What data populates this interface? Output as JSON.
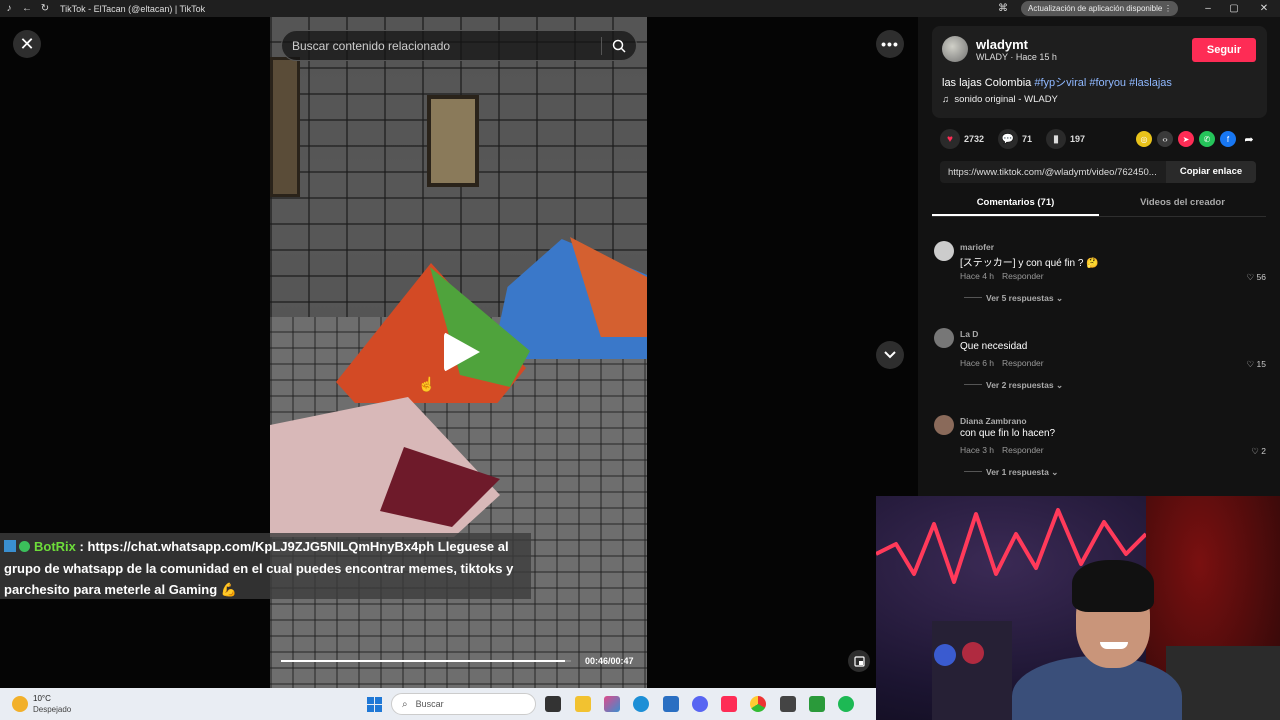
{
  "browser": {
    "tab_title": "TikTok - ElTacan (@eltacan) | TikTok",
    "update_notice": "Actualización de aplicación disponible"
  },
  "search": {
    "placeholder": "Buscar contenido relacionado"
  },
  "player": {
    "time": "00:46/00:47",
    "progress": 0.979
  },
  "chat_overlay": {
    "username": "BotRix",
    "message": ": https://chat.whatsapp.com/KpLJ9ZJG5NILQmHnyBx4ph Lleguese al grupo de whatsapp de la comunidad en el cual puedes encontrar memes, tiktoks y parchesito para meterle al Gaming 💪"
  },
  "creator": {
    "name": "wladymt",
    "sub": "WLADY · Hace 15 h",
    "follow_label": "Seguir",
    "caption_text": "las lajas Colombia",
    "hashtags": [
      "#fypシviral",
      "#foryou",
      "#laslajas"
    ],
    "sound": "sonido original - WLADY"
  },
  "stats": {
    "likes": "2732",
    "comments": "71",
    "saves": "197"
  },
  "share_icons": [
    "coin-icon",
    "embed-icon",
    "send-icon",
    "whatsapp-icon",
    "facebook-icon",
    "share-arrow-icon"
  ],
  "link": {
    "url": "https://www.tiktok.com/@wladymt/video/762450...",
    "copy_label": "Copiar enlace"
  },
  "tabs": [
    "Comentarios (71)",
    "Videos del creador"
  ],
  "comments": [
    {
      "user": "mariofer",
      "text": "[ステッカー] y con qué fin ? 🤔",
      "time": "Hace 4 h",
      "reply": "Responder",
      "likes": "56",
      "replies": "Ver 5 respuestas"
    },
    {
      "user": "La D",
      "text": "Que necesidad",
      "time": "Hace 6 h",
      "reply": "Responder",
      "likes": "15",
      "replies": "Ver 2 respuestas"
    },
    {
      "user": "Diana Zambrano",
      "text": "con que fin lo hacen?",
      "time": "Hace 3 h",
      "reply": "Responder",
      "likes": "2",
      "replies": "Ver 1 respuesta"
    }
  ],
  "taskbar": {
    "temp": "10°C",
    "weather": "Despejado",
    "search_label": "Buscar"
  },
  "colors": {
    "accent": "#fe2c55",
    "hashtag": "#8fb8ff",
    "chat_user": "#6ddc3a"
  }
}
